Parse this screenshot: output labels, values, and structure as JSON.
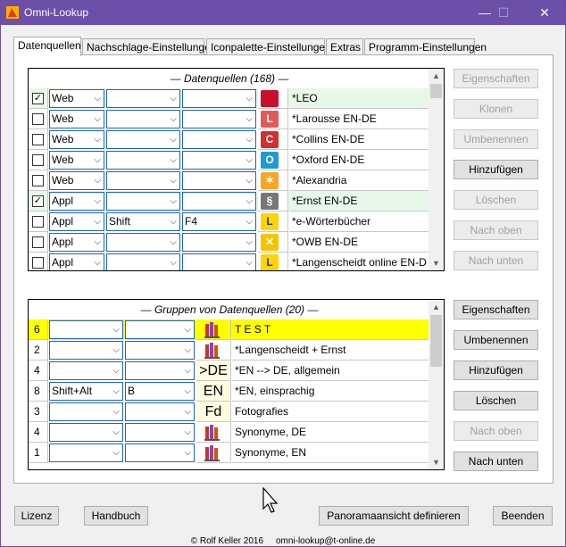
{
  "window": {
    "title": "Omni-Lookup",
    "minimize": "—",
    "maximize": "☐",
    "close": "✕"
  },
  "tabs": [
    {
      "label": "Datenquellen",
      "active": true
    },
    {
      "label": "Nachschlage-Einstellungen"
    },
    {
      "label": "Iconpalette-Einstellungen"
    },
    {
      "label": "Extras"
    },
    {
      "label": "Programm-Einstellungen"
    }
  ],
  "datasources": {
    "header": "— Datenquellen (168) —",
    "rows": [
      {
        "checked": true,
        "type": "Web",
        "mod": "",
        "key": "",
        "icon": "leo-icon",
        "icon_text": "",
        "icon_color": "#c8102e",
        "name": "*LEO",
        "highlight": "#e8f8e8"
      },
      {
        "checked": false,
        "type": "Web",
        "mod": "",
        "key": "",
        "icon": "larousse-icon",
        "icon_text": "L",
        "icon_color": "#e05a5a",
        "name": "*Larousse EN-DE",
        "highlight": ""
      },
      {
        "checked": false,
        "type": "Web",
        "mod": "",
        "key": "",
        "icon": "collins-icon",
        "icon_text": "C",
        "icon_color": "#d32f2f",
        "name": "*Collins EN-DE",
        "highlight": ""
      },
      {
        "checked": false,
        "type": "Web",
        "mod": "",
        "key": "",
        "icon": "oxford-icon",
        "icon_text": "O",
        "icon_color": "#1e9bd7",
        "name": "*Oxford EN-DE",
        "highlight": ""
      },
      {
        "checked": false,
        "type": "Web",
        "mod": "",
        "key": "",
        "icon": "alexandria-icon",
        "icon_text": "✶",
        "icon_color": "#f5a623",
        "name": "*Alexandria",
        "highlight": ""
      },
      {
        "checked": true,
        "type": "Appl",
        "mod": "",
        "key": "",
        "icon": "ernst-icon",
        "icon_text": "§",
        "icon_color": "#777777",
        "name": "*Ernst EN-DE",
        "highlight": "#e8f8e8"
      },
      {
        "checked": false,
        "type": "Appl",
        "mod": "Shift",
        "key": "F4",
        "icon": "woerterbuecher-icon",
        "icon_text": "L",
        "icon_color": "#ffd400",
        "name": "*e-Wörterbücher",
        "highlight": ""
      },
      {
        "checked": false,
        "type": "Appl",
        "mod": "",
        "key": "",
        "icon": "owb-icon",
        "icon_text": "✕",
        "icon_color": "#f5c400",
        "name": "*OWB EN-DE",
        "highlight": ""
      },
      {
        "checked": false,
        "type": "Appl",
        "mod": "",
        "key": "",
        "icon": "langenscheidt-icon",
        "icon_text": "L",
        "icon_color": "#ffd400",
        "name": "*Langenscheidt online EN-D",
        "highlight": ""
      }
    ],
    "buttons": [
      {
        "label": "Eigenschaften",
        "enabled": false
      },
      {
        "label": "Klonen",
        "enabled": false
      },
      {
        "label": "Umbenennen",
        "enabled": false
      },
      {
        "label": "Hinzufügen",
        "enabled": true
      },
      {
        "label": "Löschen",
        "enabled": false
      },
      {
        "label": "Nach oben",
        "enabled": false
      },
      {
        "label": "Nach unten",
        "enabled": false
      }
    ]
  },
  "groups": {
    "header": "— Gruppen von Datenquellen (20) —",
    "rows": [
      {
        "num": "6",
        "mod": "",
        "key": "",
        "icon": "books-icon",
        "icon_text": "",
        "name": "T E S T",
        "highlight": "#ffff00"
      },
      {
        "num": "2",
        "mod": "",
        "key": "",
        "icon": "books-icon",
        "icon_text": "",
        "name": "*Langenscheidt + Ernst",
        "highlight": ""
      },
      {
        "num": "4",
        "mod": "",
        "key": "",
        "icon": "text-icon",
        "icon_text": ">DE",
        "name": "*EN --> DE, allgemein",
        "highlight": ""
      },
      {
        "num": "8",
        "mod": "Shift+Alt",
        "key": "B",
        "icon": "text-icon",
        "icon_text": "EN",
        "name": "*EN, einsprachig",
        "highlight": ""
      },
      {
        "num": "3",
        "mod": "",
        "key": "",
        "icon": "text-icon",
        "icon_text": "Fd",
        "name": "Fotografies",
        "highlight": ""
      },
      {
        "num": "4",
        "mod": "",
        "key": "",
        "icon": "books-icon",
        "icon_text": "",
        "name": "Synonyme, DE",
        "highlight": ""
      },
      {
        "num": "1",
        "mod": "",
        "key": "",
        "icon": "books-icon",
        "icon_text": "",
        "name": "Synonyme, EN",
        "highlight": ""
      }
    ],
    "buttons": [
      {
        "label": "Eigenschaften",
        "enabled": true
      },
      {
        "label": "Umbenennen",
        "enabled": true
      },
      {
        "label": "Hinzufügen",
        "enabled": true
      },
      {
        "label": "Löschen",
        "enabled": true
      },
      {
        "label": "Nach oben",
        "enabled": false
      },
      {
        "label": "Nach unten",
        "enabled": true
      }
    ]
  },
  "bottom_buttons": {
    "lizenz": "Lizenz",
    "handbuch": "Handbuch",
    "panorama": "Panoramaansicht definieren",
    "beenden": "Beenden"
  },
  "footer": {
    "copyright": "© Rolf Keller 2016",
    "email": "omni-lookup@t-online.de"
  },
  "colors": {
    "titlebar": "#6b4fa8",
    "selected_row": "#e8f8e8",
    "group_highlight": "#ffff00",
    "combo_border": "#1e63c8"
  }
}
